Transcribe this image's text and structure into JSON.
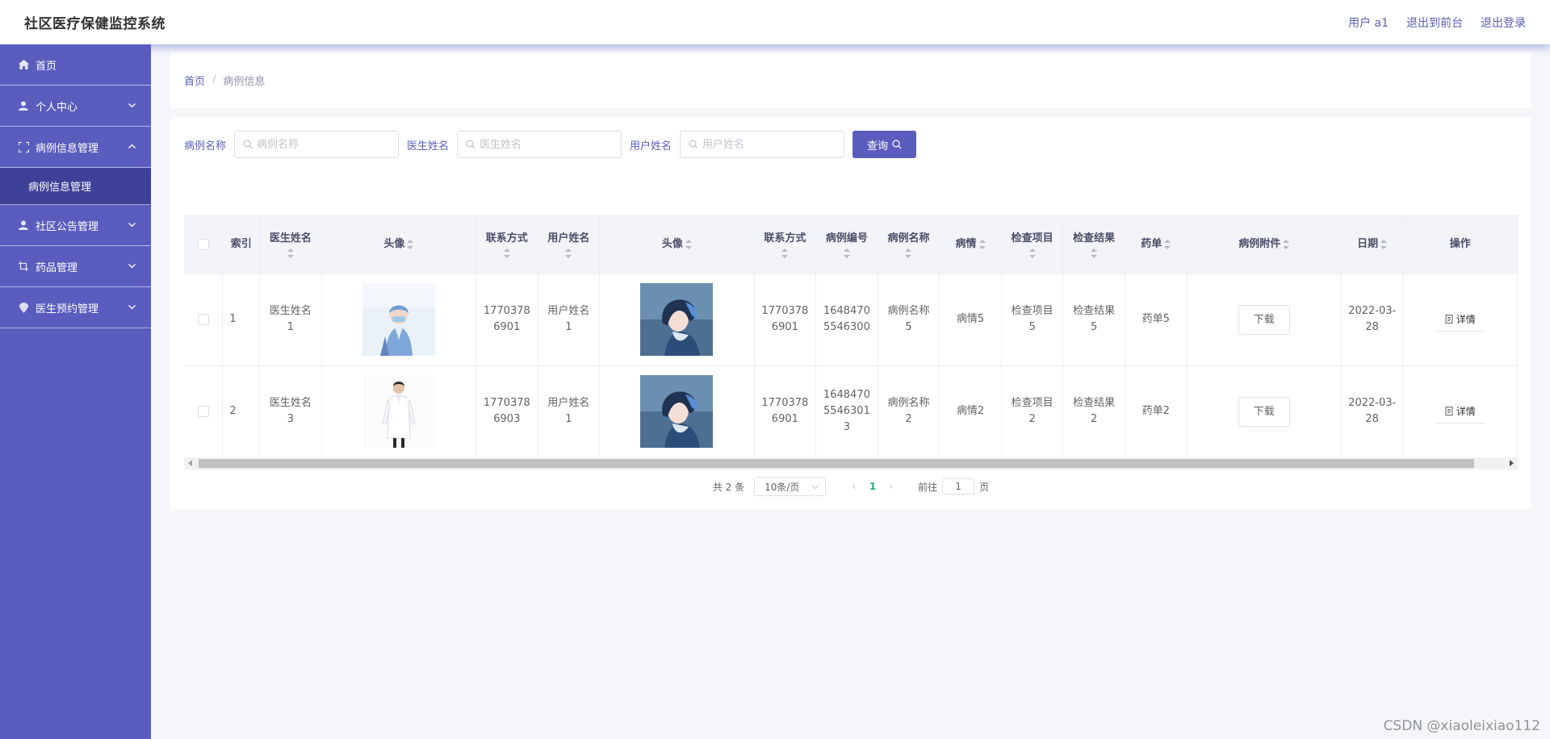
{
  "app": {
    "title": "社区医疗保健监控系统"
  },
  "header": {
    "user_label": "用户 a1",
    "front_link": "退出到前台",
    "logout_link": "退出登录"
  },
  "sidebar": {
    "items": [
      {
        "label": "首页",
        "icon": "home-icon"
      },
      {
        "label": "个人中心",
        "icon": "user-icon"
      },
      {
        "label": "病例信息管理",
        "icon": "frame-icon"
      },
      {
        "label": "社区公告管理",
        "icon": "user-icon"
      },
      {
        "label": "药品管理",
        "icon": "crop-icon"
      },
      {
        "label": "医生预约管理",
        "icon": "pin-icon"
      }
    ],
    "active_sub": "病例信息管理",
    "accent": "#5a5dbd",
    "active_bg": "#3f4199"
  },
  "breadcrumb": {
    "home": "首页",
    "separator": "/",
    "current": "病例信息"
  },
  "search": {
    "case_label": "病例名称",
    "case_placeholder": "病例名称",
    "doctor_label": "医生姓名",
    "doctor_placeholder": "医生姓名",
    "user_label": "用户姓名",
    "user_placeholder": "用户姓名",
    "button": "查询"
  },
  "table": {
    "headers": {
      "index": "索引",
      "doctor_name": "医生姓名",
      "avatar": "头像",
      "contact": "联系方式",
      "user_name": "用户姓名",
      "user_avatar": "头像",
      "user_contact": "联系方式",
      "case_no": "病例编号",
      "case_name": "病例名称",
      "condition": "病情",
      "exam_item": "检查项目",
      "exam_result": "检查结果",
      "prescription": "药单",
      "attachment": "病例附件",
      "date": "日期",
      "actions": "操作"
    },
    "rows": [
      {
        "index": "1",
        "doctor_name": "医生姓名1",
        "contact": "17703786901",
        "user_name": "用户姓名1",
        "user_contact": "17703786901",
        "case_no": "16484705546300",
        "case_name": "病例名称5",
        "condition": "病情5",
        "exam_item": "检查项目5",
        "exam_result": "检查结果5",
        "prescription": "药单5",
        "download": "下载",
        "date": "2022-03-28",
        "detail": "详情"
      },
      {
        "index": "2",
        "doctor_name": "医生姓名3",
        "contact": "17703786903",
        "user_name": "用户姓名1",
        "user_contact": "17703786901",
        "case_no": "164847055463013",
        "case_name": "病例名称2",
        "condition": "病情2",
        "exam_item": "检查项目2",
        "exam_result": "检查结果2",
        "prescription": "药单2",
        "download": "下载",
        "date": "2022-03-28",
        "detail": "详情"
      }
    ]
  },
  "pagination": {
    "total": "共 2 条",
    "page_size": "10条/页",
    "current_page": "1",
    "goto_label": "前往",
    "goto_value": "1",
    "page_unit": "页"
  },
  "watermark": "CSDN @xiaoleixiao112"
}
